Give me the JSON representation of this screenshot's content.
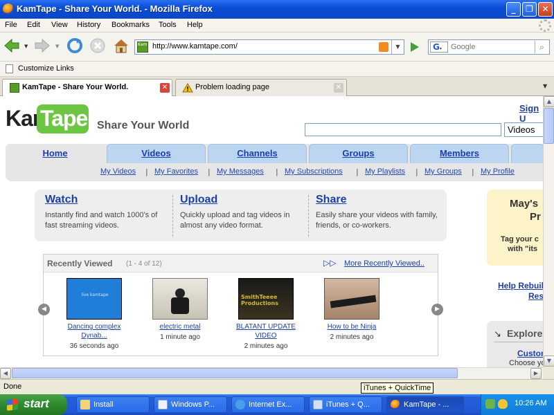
{
  "window": {
    "title": "KamTape - Share Your World. - Mozilla Firefox"
  },
  "menu": [
    "File",
    "Edit",
    "View",
    "History",
    "Bookmarks",
    "Tools",
    "Help"
  ],
  "address": {
    "url": "http://www.kamtape.com/",
    "favicon_text": "Kam"
  },
  "search": {
    "placeholder": "Google"
  },
  "bookmarks": {
    "item": "Customize Links"
  },
  "tabs": [
    {
      "label": "KamTape - Share Your World.",
      "active": true
    },
    {
      "label": "Problem loading page",
      "active": false
    }
  ],
  "page": {
    "logo_kam": "Kam",
    "logo_tape": "Tape",
    "tagline": "Share Your World",
    "signup": "Sign U",
    "search_scope": "Videos",
    "nav_tabs": [
      "Home",
      "Videos",
      "Channels",
      "Groups",
      "Members"
    ],
    "sub_links": [
      "My Videos",
      "My Favorites",
      "My Messages",
      "My Subscriptions",
      "My Playlists",
      "My Groups",
      "My Profile"
    ],
    "features": [
      {
        "title": "Watch",
        "desc": "Instantly find and watch 1000's of fast streaming videos."
      },
      {
        "title": "Upload",
        "desc": "Quickly upload and tag videos in almost any video format."
      },
      {
        "title": "Share",
        "desc": "Easily share your videos with family, friends, or co-workers."
      }
    ],
    "recent": {
      "title": "Recently Viewed",
      "count": "(1 - 4 of 12)",
      "more": "More Recently Viewed..",
      "videos": [
        {
          "title": "Dancing complex Dynab...",
          "time": "36 seconds ago",
          "thumb_text": "live kamtape"
        },
        {
          "title": "electric metal",
          "time": "1 minute ago",
          "thumb_text": ""
        },
        {
          "title": "BLATANT UPDATE VIDEO",
          "time": "2 minutes ago",
          "thumb_text": "SmithTeeee Productions"
        },
        {
          "title": "How to be Ninja",
          "time": "2 minutes ago",
          "thumb_text": ""
        }
      ]
    },
    "side_promo": {
      "line1": "May's",
      "line2": "Pr",
      "line3": "Tag your c",
      "line4": "with \"its"
    },
    "side_help": {
      "line1": "Help Rebuil",
      "line2": "Res"
    },
    "explore": {
      "title": "Explore",
      "link": "Custom",
      "sub": "Choose yo"
    }
  },
  "status": {
    "text": "Done"
  },
  "tooltip": "iTunes + QuickTime",
  "taskbar": {
    "start": "start",
    "items": [
      "Install",
      "Windows P...",
      "Internet Ex...",
      "iTunes + Q...",
      "KamTape - ..."
    ],
    "clock": "10:26 AM"
  },
  "colors": {
    "kam_green": "#6cc644",
    "link_blue": "#1b3fa5",
    "xp_blue": "#245edb"
  }
}
